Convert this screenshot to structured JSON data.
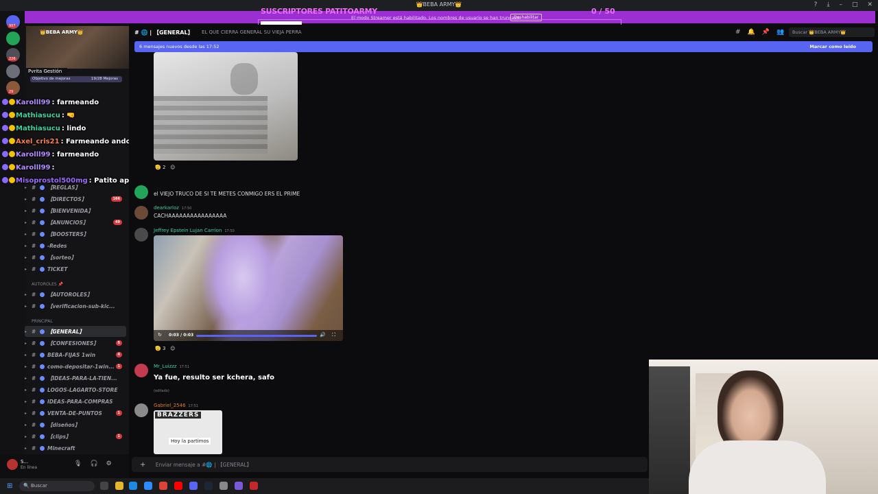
{
  "window": {
    "title": "👑BEBA ARMY👑"
  },
  "overlay": {
    "sub_title": "SUSCRIPTORES PATITOARMY",
    "sub_count": "0 / 50",
    "stream_notice": "El modo Streamer está habilitado. Los nombres de usuario se han truncado.",
    "notice_button": "Deshabilitar"
  },
  "server": {
    "name": "👑BEBA ARMY👑",
    "tooltip": "Pvrita Gestión",
    "goal_label": "Objetivo de mejoras",
    "goal_value": "19/28 Mejoras"
  },
  "server_badges": [
    "997",
    "",
    "226",
    "",
    "29"
  ],
  "twitch_chat": [
    {
      "user": "Karolll99",
      "text": ": farmeando",
      "color": "#b48cff"
    },
    {
      "user": "Mathiasucu",
      "text": ": 🤜",
      "color": "#3ed2a0"
    },
    {
      "user": "Mathiasucu",
      "text": ": lindo",
      "color": "#3ed2a0"
    },
    {
      "user": "Axel_cris21",
      "text": ": Farmeando ando",
      "color": "#ff7f50"
    },
    {
      "user": "Karolll99",
      "text": ": farmeando",
      "color": "#b48cff"
    },
    {
      "user": "Karolll99",
      "text": ":",
      "color": "#b48cff"
    },
    {
      "user": "Misoprostol500mg",
      "text": ": Patito aprobé en mi examen waaaaa",
      "color": "#9b6bff"
    }
  ],
  "channels": [
    {
      "label": "【REGLAS】",
      "count": ""
    },
    {
      "label": "【DIRECTOS】",
      "count": "166"
    },
    {
      "label": "【BIENVENIDA】",
      "count": ""
    },
    {
      "label": "【ANUNCIOS】",
      "count": "49"
    },
    {
      "label": "【BOOSTERS】",
      "count": ""
    },
    {
      "label": "-Redes",
      "count": ""
    },
    {
      "label": "【sorteo】",
      "count": ""
    },
    {
      "label": "TICKET",
      "count": ""
    }
  ],
  "category_autoroles": "AUTOROLES 📌",
  "channels_autoroles": [
    {
      "label": "【AUTOROLES】",
      "count": ""
    },
    {
      "label": "【verificacion-sub-kic...",
      "count": ""
    }
  ],
  "category_principal": "PRINCIPAL",
  "channels_principal": [
    {
      "label": "【GENERAL】",
      "count": ""
    },
    {
      "label": "【CONFESIONES】",
      "count": "5"
    },
    {
      "label": "BEBA-FIJAS 1win",
      "count": "4"
    },
    {
      "label": "como-depositar-1win...",
      "count": "1"
    },
    {
      "label": "【IDEAS-PARA-LA-TIEN...",
      "count": ""
    },
    {
      "label": "LOGOS-LAGARTO-STORE",
      "count": ""
    },
    {
      "label": "IDEAS-PARA-COMPRAS",
      "count": ""
    },
    {
      "label": "VENTA-DE-PUNTOS",
      "count": "1"
    },
    {
      "label": "【diseños】",
      "count": ""
    },
    {
      "label": "【clips】",
      "count": "1"
    },
    {
      "label": "Minecraft",
      "count": ""
    }
  ],
  "user": {
    "name": "S...",
    "status": "En línea"
  },
  "channel": {
    "title": "【GENERAL】",
    "topic": "EL QUE CIERRA GENERAL SU VIEJA PERRA"
  },
  "search": {
    "placeholder": "Buscar 👑BEBA ARMY👑"
  },
  "new_messages": {
    "text": "6 mensajes nuevos desde las 17:52",
    "action": "Marcar como leído"
  },
  "messages": [
    {
      "user": "",
      "time": "",
      "text": "el VIEJO TRUCO  DE SI TE METES CONMIGO ERS EL PRIME"
    },
    {
      "user": "dearkarloz",
      "time": "17:50",
      "text": "CACHAAAAAAAAAAAAAAAA"
    },
    {
      "user": "Jeffrey Epstein Lujan Carrion",
      "time": "17:50",
      "text": ""
    },
    {
      "user": "Mr_Luizzz",
      "time": "17:51",
      "text": "Ya fue, resulto ser kchera, safo",
      "edited": "(editado)"
    },
    {
      "user": "Gabriel_2546",
      "time": "17:51",
      "text": ""
    }
  ],
  "reactions": [
    "2",
    "3"
  ],
  "video": {
    "time": "0:03 / 0:03"
  },
  "gif": {
    "brand": "BRAZZERS",
    "caption": "Hoy la partimos"
  },
  "composer": {
    "placeholder": "Enviar mensaje a #🌐 | 【GENERAL】"
  },
  "taskbar": {
    "search": "Buscar"
  }
}
